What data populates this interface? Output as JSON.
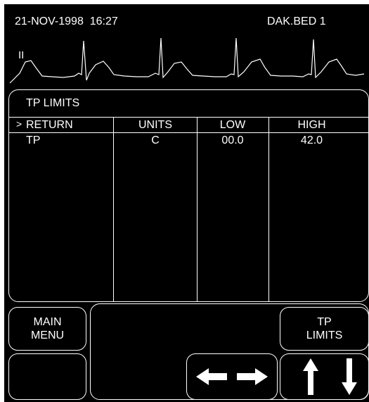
{
  "header": {
    "datetime": "21-NOV-1998  16:27",
    "bed": "DAK.BED 1"
  },
  "waveform": {
    "lead": "II",
    "color": "#ffffff"
  },
  "limits_panel": {
    "title": "TP LIMITS",
    "cursor": ">",
    "columns": [
      "RETURN",
      "UNITS",
      "LOW",
      "HIGH"
    ],
    "rows": [
      {
        "name": "TP",
        "units": "C",
        "low": "00.0",
        "high": "42.0"
      }
    ]
  },
  "buttons": {
    "main_menu": [
      "MAIN",
      "MENU"
    ],
    "tp_limits": [
      "TP",
      "LIMITS"
    ],
    "arrows_lr": "left-right-arrows-icon",
    "arrows_ud": "up-down-arrows-icon"
  },
  "colors": {
    "background": "#000000",
    "foreground": "#ffffff"
  }
}
